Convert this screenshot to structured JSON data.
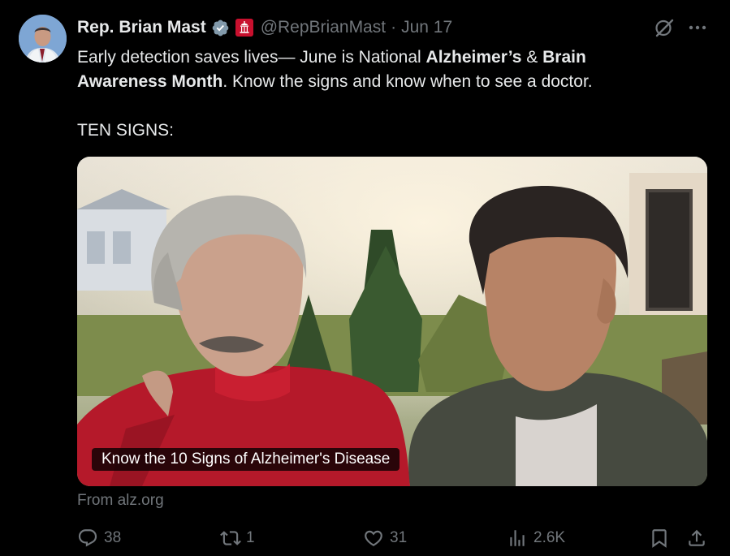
{
  "author": {
    "name": "Rep. Brian Mast",
    "handle": "@RepBrianMast",
    "separator": "·",
    "date": "Jun 17"
  },
  "post": {
    "line1_a": "Early detection saves lives— June is National ",
    "line1_b": "Alzheimer’s",
    "line1_c": " & ",
    "line1_d": "Brain",
    "line2_a": "Awareness Month",
    "line2_b": ". Know the signs and know when to see a doctor.",
    "line3": "TEN SIGNS:"
  },
  "card": {
    "caption": "Know the 10 Signs of Alzheimer's Disease",
    "source": "From alz.org"
  },
  "actions": {
    "replies": "38",
    "reposts": "1",
    "likes": "31",
    "views": "2.6K"
  },
  "icons": {
    "verified": "verified-badge-icon",
    "government": "government-label-icon",
    "grok": "grok-icon",
    "more": "more-icon",
    "reply": "reply-icon",
    "repost": "repost-icon",
    "like": "heart-icon",
    "views": "analytics-icon",
    "bookmark": "bookmark-icon",
    "share": "share-icon"
  },
  "colors": {
    "background": "#000000",
    "text": "#e7e9ea",
    "muted": "#71767b",
    "verified_gray": "#829aab",
    "gov_red": "#c8102e"
  }
}
